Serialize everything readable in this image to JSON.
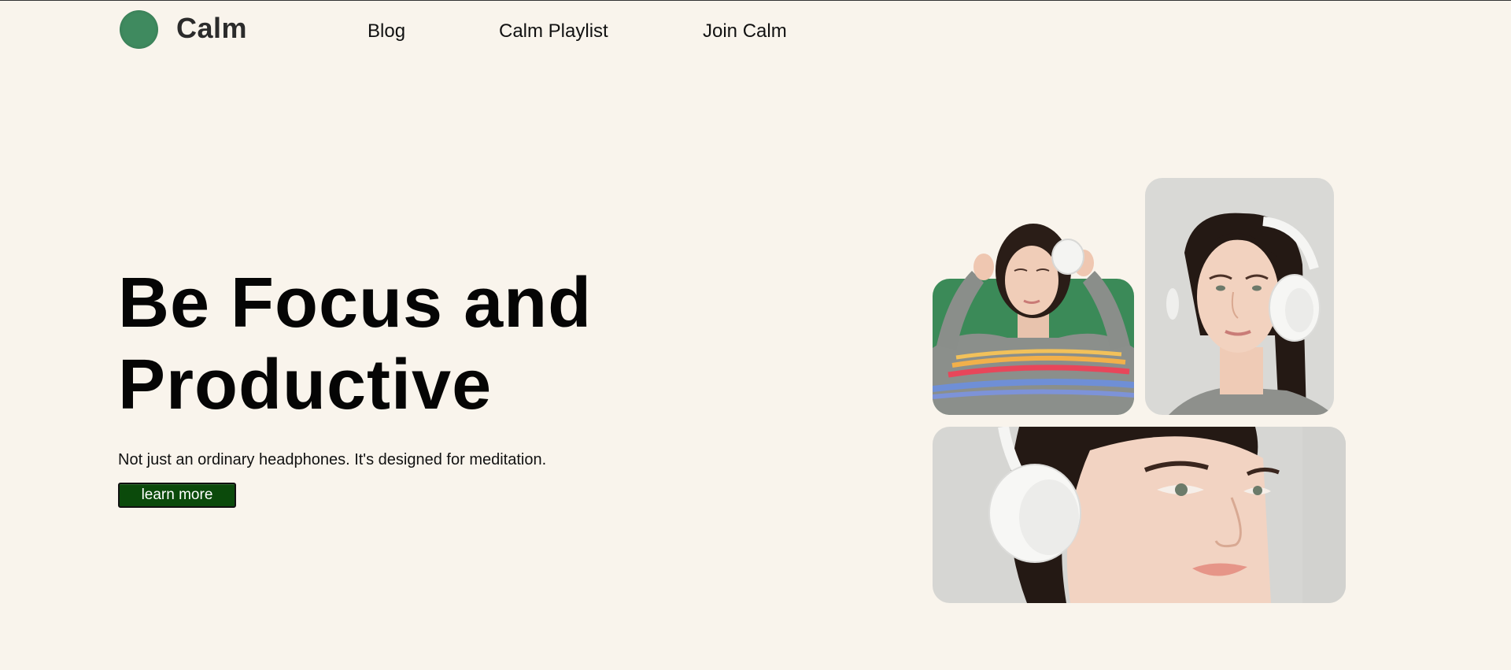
{
  "nav": {
    "brand": "Calm",
    "links": [
      "Blog",
      "Calm Playlist",
      "Join Calm"
    ]
  },
  "hero": {
    "title_line1": "Be Focus and",
    "title_line2": "Productive",
    "subtitle": "Not just an ordinary headphones. It's designed for meditation.",
    "button_label": "learn more"
  },
  "colors": {
    "background": "#f9f4ec",
    "brand_green": "#3f8a5f",
    "button_green": "#0b4a0b"
  },
  "gallery": {
    "images": [
      "woman-headphones-green-backdrop",
      "woman-white-headphones-portrait",
      "woman-headphones-closeup"
    ]
  }
}
